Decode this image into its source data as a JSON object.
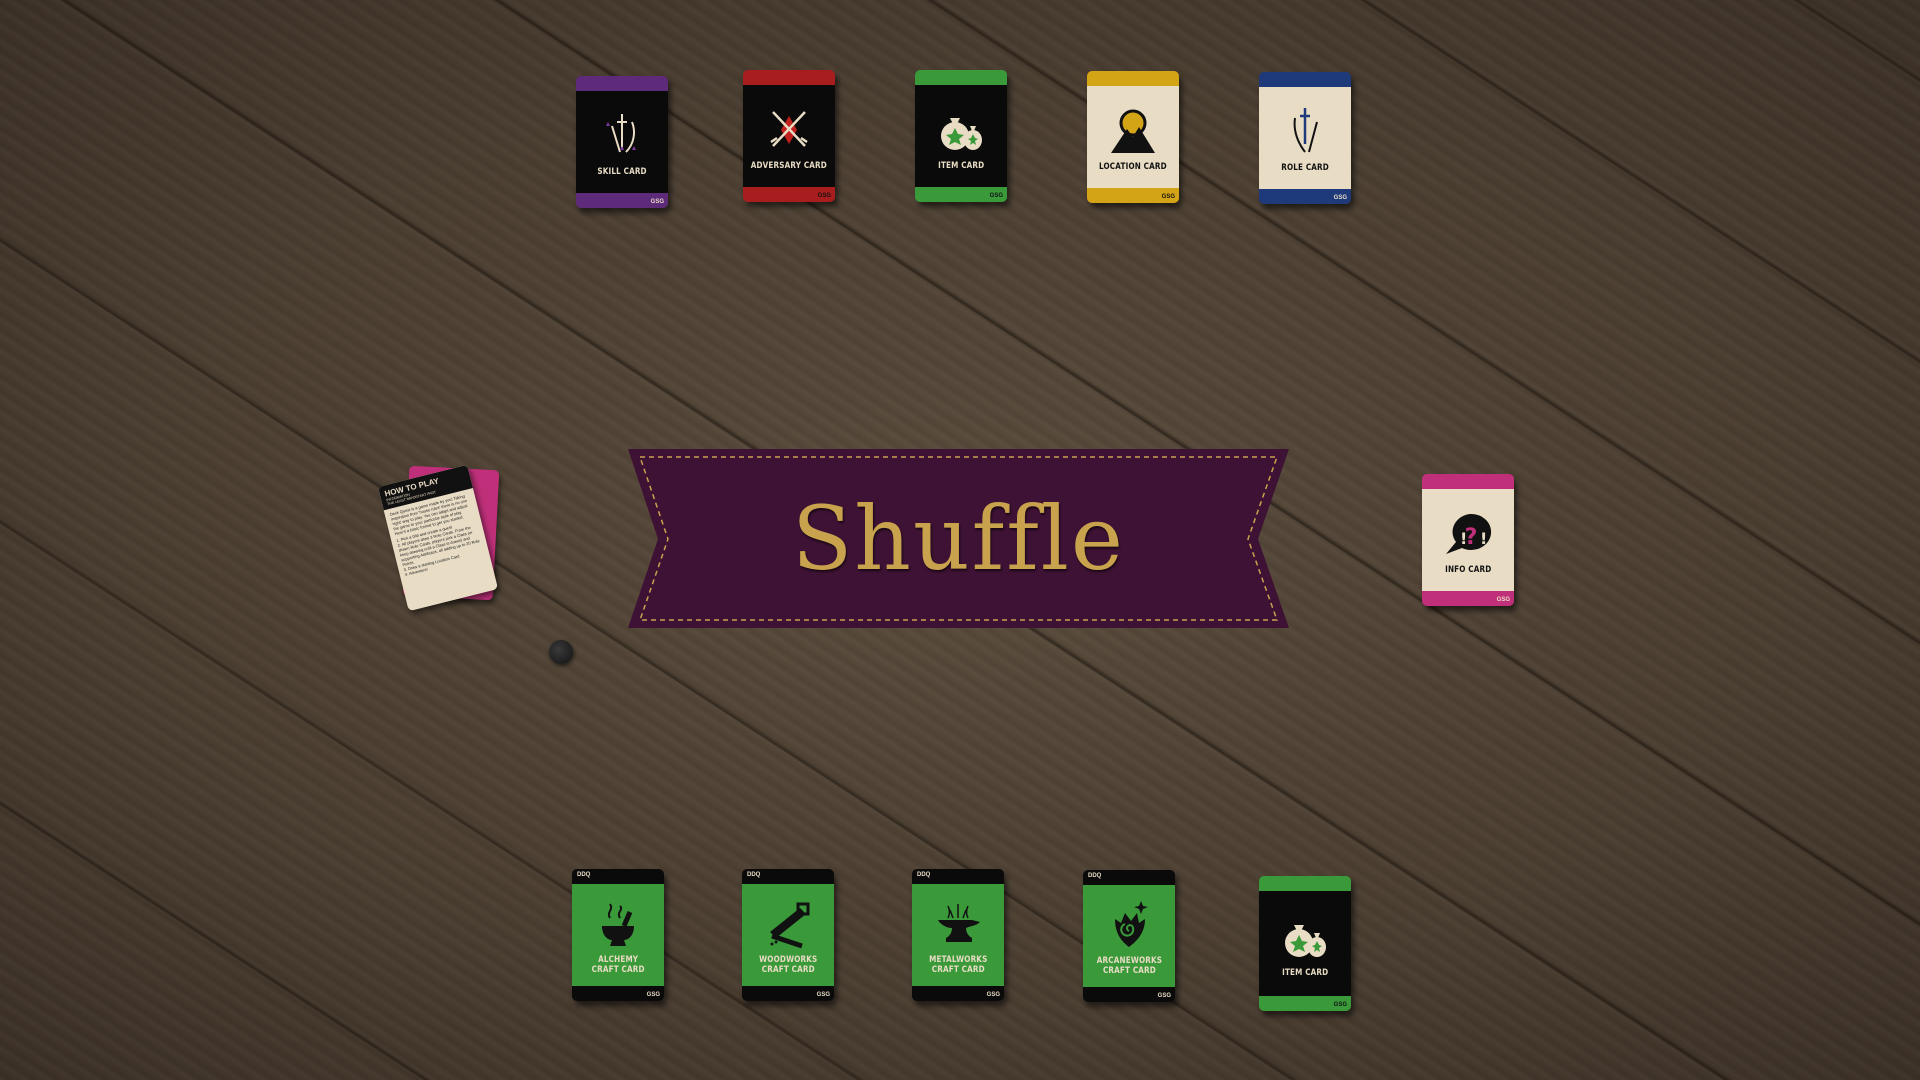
{
  "title": "Shuffle",
  "top_cards": [
    {
      "label": "SKILL CARD",
      "brand": "GSG",
      "color": "#5e2a7a",
      "body": "#0a0a0a",
      "text": "#e8dcc4",
      "icon": "sword-bow-stars-icon"
    },
    {
      "label": "ADVERSARY CARD",
      "brand": "GSG",
      "color": "#a81e1e",
      "body": "#0a0a0a",
      "text": "#e8dcc4",
      "icon": "crossed-swords-icon"
    },
    {
      "label": "ITEM CARD",
      "brand": "GSG",
      "color": "#3a9a3a",
      "body": "#0a0a0a",
      "text": "#e8dcc4",
      "icon": "loot-bags-icon"
    },
    {
      "label": "LOCATION CARD",
      "brand": "GSG",
      "color": "#d4a417",
      "body": "#e8dcc4",
      "text": "#111",
      "icon": "compass-mountain-icon"
    },
    {
      "label": "ROLE CARD",
      "brand": "GSG",
      "color": "#1e3a7a",
      "body": "#e8dcc4",
      "text": "#111",
      "icon": "sword-bow-icon"
    }
  ],
  "info_card": {
    "label": "INFO CARD",
    "brand": "GSG",
    "color": "#c0307a",
    "icon": "speech-bubble-question-icon"
  },
  "how_to_play": {
    "title": "HOW TO PLAY",
    "subtitle": "INFORMATION\nTHE LEAST IMPORTANT PART",
    "intro": "Deck Quest is a game made by you! Taking inspiration from 'house rules' there is no one 'right' way to play. You can adapt and adjust the game to your particular style of play. Here's a basic format to get you started:",
    "steps": [
      "1. Pick a GM and create a quest",
      "2. All players draw 3 Role Cards. From the drawn Role Cards, players pick a Class (or keep drawing until a Class is drawn) and supporting Attributes, all adding up to 20 Role Points.",
      "3. Draw a starting Location Card",
      "4. Adventure!"
    ]
  },
  "bottom_cards": [
    {
      "label": "ALCHEMY\nCRAFT CARD",
      "brand": "GSG",
      "top": "DDQ",
      "icon": "mortar-pestle-icon"
    },
    {
      "label": "WOODWORKS\nCRAFT CARD",
      "brand": "GSG",
      "top": "DDQ",
      "icon": "saw-icon"
    },
    {
      "label": "METALWORKS\nCRAFT CARD",
      "brand": "GSG",
      "top": "DDQ",
      "icon": "anvil-icon"
    },
    {
      "label": "ARCANEWORKS\nCRAFT CARD",
      "brand": "GSG",
      "top": "DDQ",
      "icon": "arcane-flame-icon"
    }
  ],
  "bottom_item_card": {
    "label": "ITEM CARD",
    "brand": "GSG",
    "icon": "loot-bags-icon"
  },
  "colors": {
    "banner": "#3e1234",
    "banner_stitch": "#c9a24e",
    "craft_green": "#3a9a3a",
    "cream": "#e8dcc4"
  }
}
